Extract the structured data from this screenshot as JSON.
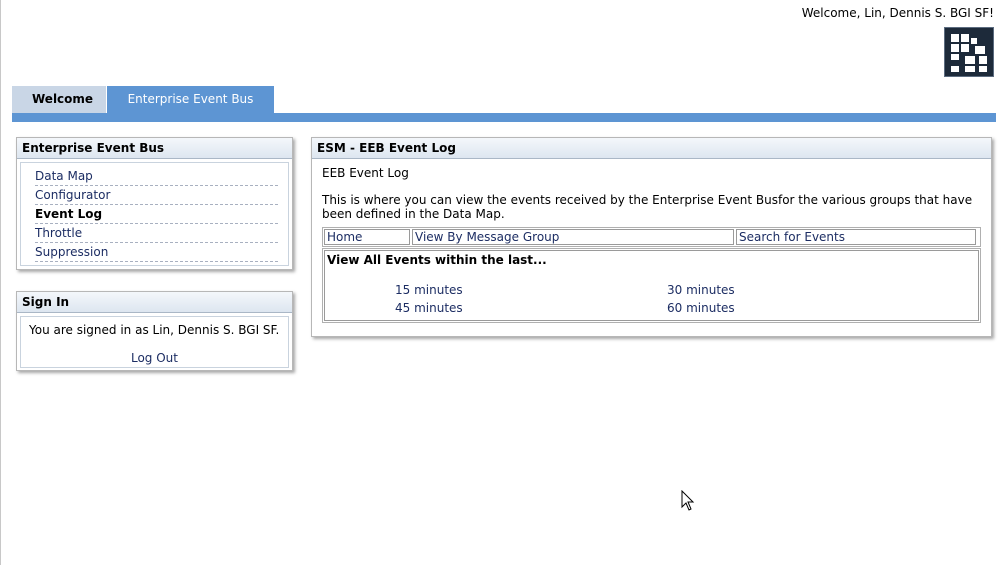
{
  "header": {
    "welcome": "Welcome, Lin, Dennis S. BGI SF!"
  },
  "tabs": [
    {
      "label": "Welcome",
      "active": false
    },
    {
      "label": "Enterprise Event Bus",
      "active": true
    }
  ],
  "sidebar": {
    "title": "Enterprise Event Bus",
    "items": [
      {
        "label": "Data Map"
      },
      {
        "label": "Configurator"
      },
      {
        "label": "Event Log",
        "current": true
      },
      {
        "label": "Throttle"
      },
      {
        "label": "Suppression"
      }
    ]
  },
  "signin": {
    "title": "Sign In",
    "status": "You are signed in as Lin, Dennis S. BGI SF.",
    "logout": "Log Out"
  },
  "main": {
    "title": "ESM - EEB Event Log",
    "subtitle": "EEB Event Log",
    "description": "This is where you can view the events received by the Enterprise Event Busfor the various groups that have been defined in the Data Map.",
    "subnav": [
      {
        "label": "Home"
      },
      {
        "label": "View By Message Group"
      },
      {
        "label": "Search for Events"
      }
    ],
    "events_title": "View All Events within the last...",
    "event_links": [
      "15 minutes",
      "30 minutes",
      "45 minutes",
      "60 minutes"
    ]
  },
  "colors": {
    "tab_active": "#5d95d3",
    "tab_inactive": "#c9d6e6",
    "link": "#1c2d63"
  }
}
